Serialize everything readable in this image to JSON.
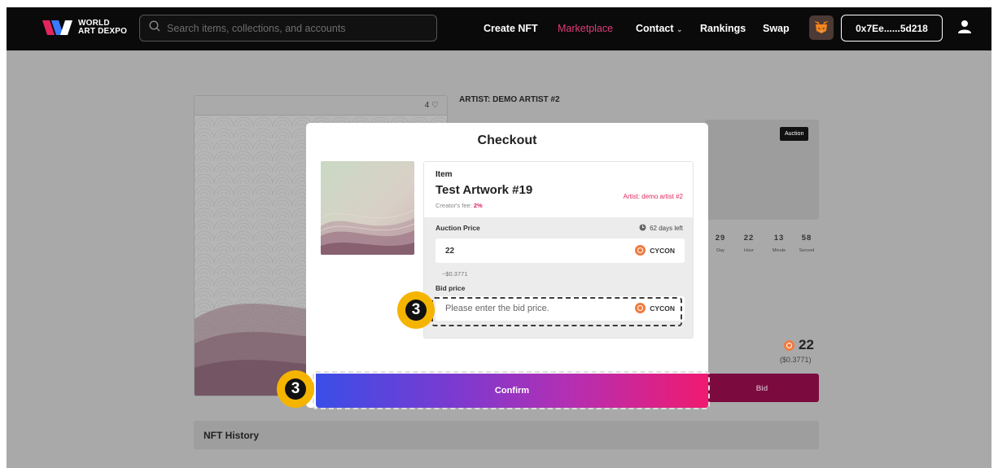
{
  "header": {
    "logo_line1": "WORLD",
    "logo_line2": "ART DEXPO",
    "search_placeholder": "Search items, collections, and accounts",
    "nav": {
      "create": "Create NFT",
      "marketplace": "Marketplace",
      "contact": "Contact",
      "rankings": "Rankings",
      "swap": "Swap"
    },
    "wallet_address": "0x7Ee......5d218",
    "colors": {
      "active_link": "#e23a7a",
      "background": "#0a0a0a"
    }
  },
  "background_page": {
    "like_count": "4",
    "artist_heading": "ARTIST: DEMO ARTIST #2",
    "auction_badge": "Auction",
    "timer": [
      {
        "value": "29",
        "label": "Day"
      },
      {
        "value": "22",
        "label": "Hour"
      },
      {
        "value": "13",
        "label": "Minute"
      },
      {
        "value": "58",
        "label": "Second"
      }
    ],
    "price": "22",
    "price_usd": "($0.3771)",
    "bid_button": "Bid",
    "history_title": "NFT History"
  },
  "modal": {
    "title": "Checkout",
    "item_label": "Item",
    "item_name": "Test Artwork #19",
    "creator_fee_label": "Creator's fee:",
    "creator_fee_value": "2%",
    "artist": "Artist: demo artist #2",
    "auction_price_label": "Auction Price",
    "days_left": "62 days left",
    "auction_price_value": "22",
    "token_symbol": "CYCON",
    "approx_usd": "~$0.3771",
    "bid_price_label": "Bid price",
    "bid_placeholder": "Please enter the bid price.",
    "confirm_label": "Confirm",
    "colors": {
      "accent_pink": "#e0285e",
      "coin": "#f07b3f"
    }
  },
  "annotations": {
    "step_number": "3",
    "step_color": "#f5b400"
  }
}
